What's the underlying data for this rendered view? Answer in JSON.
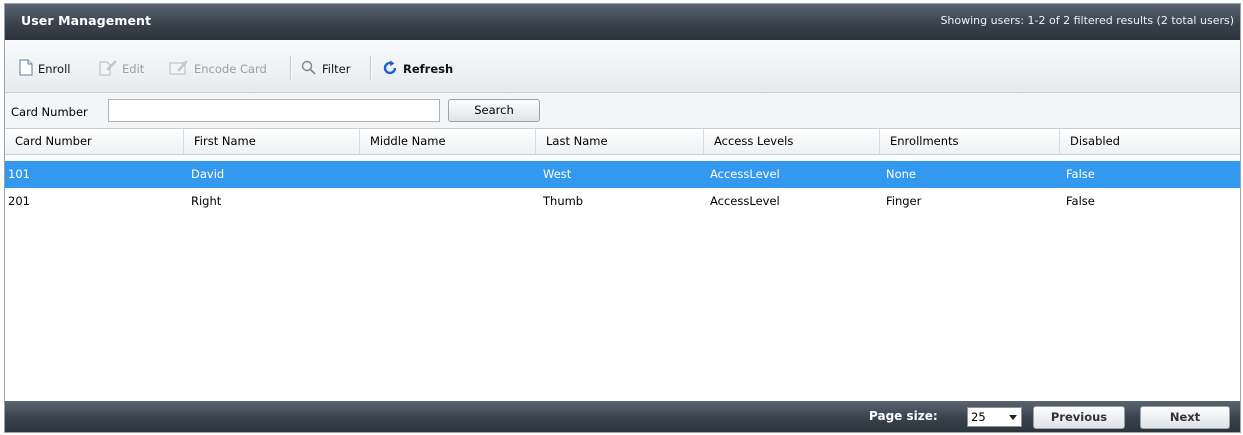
{
  "header": {
    "title": "User Management",
    "summary": "Showing users: 1-2 of 2 filtered results (2 total users)"
  },
  "toolbar": {
    "enroll": "Enroll",
    "edit": "Edit",
    "encode_card": "Encode Card",
    "filter": "Filter",
    "refresh": "Refresh"
  },
  "search": {
    "label": "Card Number",
    "value": "",
    "button": "Search"
  },
  "grid": {
    "columns": [
      "Card Number",
      "First Name",
      "Middle Name",
      "Last Name",
      "Access Levels",
      "Enrollments",
      "Disabled"
    ],
    "rows": [
      {
        "card": "101",
        "first": "David",
        "middle": "",
        "last": "West",
        "access": "AccessLevel",
        "enroll": "None",
        "disabled": "False",
        "selected": true
      },
      {
        "card": "201",
        "first": "Right",
        "middle": "",
        "last": "Thumb",
        "access": "AccessLevel",
        "enroll": "Finger",
        "disabled": "False",
        "selected": false
      }
    ]
  },
  "footer": {
    "page_size_label": "Page size:",
    "page_size": "25",
    "previous": "Previous",
    "next": "Next"
  },
  "colors": {
    "selection": "#3399ee",
    "header_dark": "#3a424c",
    "refresh_icon": "#1f5fd6"
  }
}
